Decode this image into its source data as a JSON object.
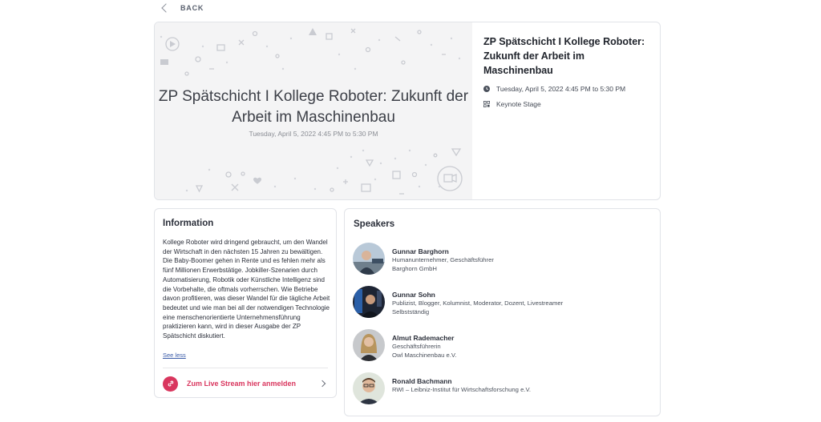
{
  "back": {
    "label": "BACK"
  },
  "hero": {
    "thumb_title": "ZP Spätschicht I Kollege Roboter: Zukunft der Arbeit im Maschinenbau",
    "thumb_date": "Tuesday, April 5, 2022 4:45 PM to 5:30 PM",
    "title": "ZP Spätschicht I Kollege Roboter: Zukunft der Arbeit im Maschinenbau",
    "datetime": "Tuesday, April 5, 2022 4:45 PM to 5:30 PM",
    "location": "Keynote Stage"
  },
  "information": {
    "heading": "Information",
    "description": "Kollege Roboter wird dringend gebraucht, um den Wandel der Wirtschaft in den nächsten 15 Jahren zu bewältigen. Die Baby-Boomer gehen in Rente und es fehlen mehr als fünf Millionen Erwerbstätige. Jobkiller-Szenarien durch Automatisierung, Robotik oder Künstliche Intelligenz sind die Vorbehalte, die oftmals vorherrschen. Wie Betriebe davon profitieren, was dieser Wandel für die tägliche Arbeit bedeutet und wie man bei all der notwendigen Technologie eine menschenorientierte Unternehmensführung praktizieren kann, wird in dieser Ausgabe der ZP Spätschicht diskutiert.",
    "see_less": "See less",
    "stream_label": "Zum Live Stream hier anmelden"
  },
  "speakers": {
    "heading": "Speakers",
    "items": [
      {
        "name": "Gunnar Barghorn",
        "line1": "Humanunternehmer, Geschäftsführer",
        "line2": "Barghorn GmbH"
      },
      {
        "name": "Gunnar Sohn",
        "line1": "Publizist, Blogger, Kolumnist, Moderator, Dozent, Livestreamer",
        "line2": "Selbstständig"
      },
      {
        "name": "Almut Rademacher",
        "line1": "Geschäftsführerin",
        "line2": "Owl Maschinenbau e.V."
      },
      {
        "name": "Ronald Bachmann",
        "line1": "RWI – Leibniz-Institut für Wirtschaftsforschung e.V.",
        "line2": ""
      }
    ]
  },
  "icons": {
    "back": "chevron-left-icon",
    "clock": "clock-icon",
    "location": "location-grid-icon",
    "link": "link-icon",
    "chevron": "chevron-right-icon"
  },
  "colors": {
    "accent": "#d9365e",
    "border": "#e1e3e8",
    "thumb_bg": "#f4f4f5"
  }
}
